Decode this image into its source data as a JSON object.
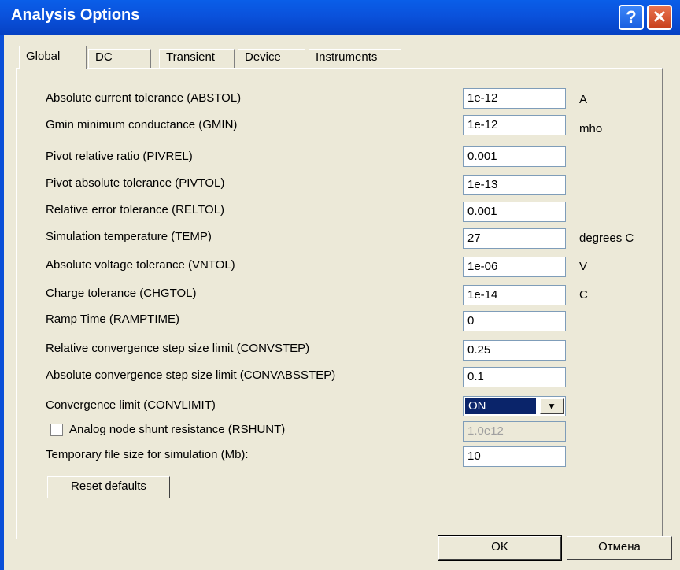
{
  "window": {
    "title": "Analysis Options",
    "help_label": "?",
    "close_label": "✕"
  },
  "tabs": [
    {
      "label": "Global"
    },
    {
      "label": "DC"
    },
    {
      "label": "Transient"
    },
    {
      "label": "Device"
    },
    {
      "label": "Instruments"
    }
  ],
  "options": [
    {
      "label": "Absolute current tolerance (ABSTOL)",
      "value": "1e-12",
      "unit": "A"
    },
    {
      "label": "Gmin minimum conductance (GMIN)",
      "value": "1e-12",
      "unit": "mho"
    },
    {
      "label": "Pivot relative ratio (PIVREL)",
      "value": "0.001",
      "unit": ""
    },
    {
      "label": "Pivot absolute tolerance (PIVTOL)",
      "value": "1e-13",
      "unit": ""
    },
    {
      "label": "Relative error tolerance (RELTOL)",
      "value": "0.001",
      "unit": ""
    },
    {
      "label": "Simulation temperature (TEMP)",
      "value": "27",
      "unit": "degrees C"
    },
    {
      "label": "Absolute voltage tolerance (VNTOL)",
      "value": "1e-06",
      "unit": "V"
    },
    {
      "label": "Charge tolerance (CHGTOL)",
      "value": "1e-14",
      "unit": "C"
    },
    {
      "label": "Ramp Time (RAMPTIME)",
      "value": "0",
      "unit": ""
    },
    {
      "label": "Relative convergence step size limit (CONVSTEP)",
      "value": "0.25",
      "unit": ""
    },
    {
      "label": "Absolute convergence step size limit (CONVABSSTEP)",
      "value": "0.1",
      "unit": ""
    }
  ],
  "convergence": {
    "label": "Convergence limit (CONVLIMIT)",
    "value": "ON"
  },
  "rshunt": {
    "label": "Analog node shunt resistance (RSHUNT)",
    "value": "1.0e12",
    "checked": false
  },
  "tempfile": {
    "label": "Temporary file size for simulation (Mb):",
    "value": "10"
  },
  "buttons": {
    "reset": "Reset defaults",
    "ok": "OK",
    "cancel": "Отмена"
  }
}
